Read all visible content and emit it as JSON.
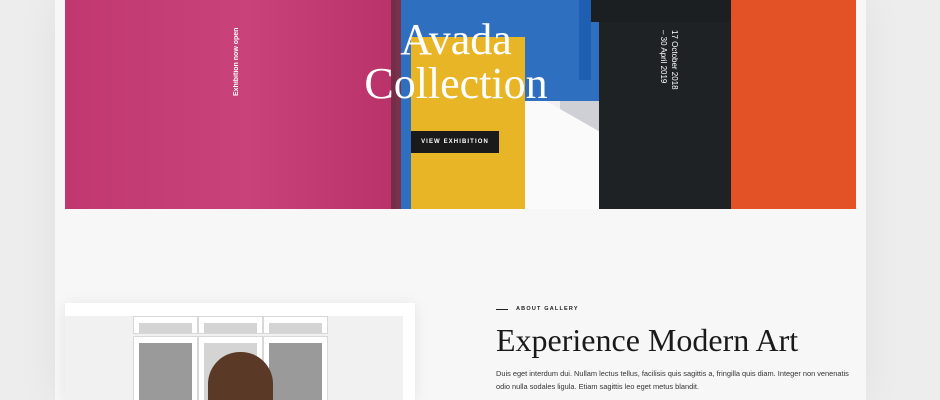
{
  "hero": {
    "title_line1": "Avada",
    "title_line2": "Collection",
    "button_label": "VIEW EXHIBITION",
    "vertical_left": "Exhibition now open",
    "date_line1": "17 October 2018",
    "date_line2": "– 30 April 2019"
  },
  "about": {
    "eyebrow": "ABOUT GALLERY",
    "heading": "Experience Modern Art",
    "paragraph": "Duis eget interdum dui. Nullam lectus tellus, facilisis quis sagittis a, fringilla quis diam. Integer non venenatis odio nulla sodales ligula. Etiam sagittis leo eget metus blandit."
  },
  "colors": {
    "pink": "#c43d77",
    "blue": "#2f6fc0",
    "yellow": "#e8b526",
    "orange": "#e35226",
    "button": "#1a1a1a"
  }
}
